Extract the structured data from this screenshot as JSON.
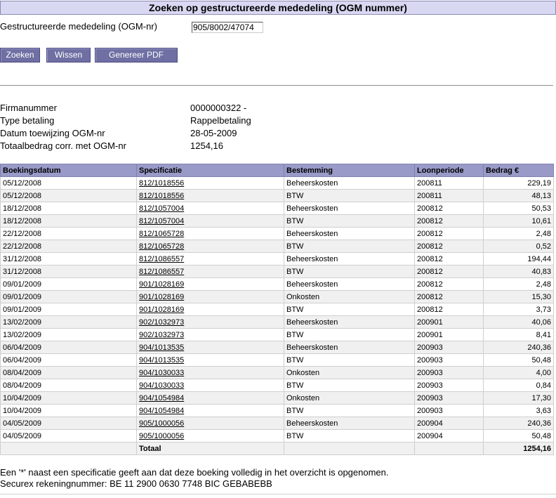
{
  "title": "Zoeken op gestructureerde mededeling (OGM nummer)",
  "form": {
    "label": "Gestructureerde mededeling (OGM-nr)",
    "value": "905/8002/47074"
  },
  "buttons": {
    "search": "Zoeken",
    "clear": "Wissen",
    "pdf": "Genereer PDF"
  },
  "info": [
    {
      "label": "Firmanummer",
      "value": "0000000322 -"
    },
    {
      "label": "Type betaling",
      "value": "Rappelbetaling"
    },
    {
      "label": "Datum toewijzing OGM-nr",
      "value": "28-05-2009"
    },
    {
      "label": "Totaalbedrag corr. met OGM-nr",
      "value": "1254,16"
    }
  ],
  "table": {
    "headers": [
      "Boekingsdatum",
      "Specificatie",
      "Bestemming",
      "Loonperiode",
      "Bedrag €"
    ],
    "rows": [
      [
        "05/12/2008",
        "812/1018556",
        "Beheerskosten",
        "200811",
        "229,19"
      ],
      [
        "05/12/2008",
        "812/1018556",
        "BTW",
        "200811",
        "48,13"
      ],
      [
        "18/12/2008",
        "812/1057004",
        "Beheerskosten",
        "200812",
        "50,53"
      ],
      [
        "18/12/2008",
        "812/1057004",
        "BTW",
        "200812",
        "10,61"
      ],
      [
        "22/12/2008",
        "812/1065728",
        "Beheerskosten",
        "200812",
        "2,48"
      ],
      [
        "22/12/2008",
        "812/1065728",
        "BTW",
        "200812",
        "0,52"
      ],
      [
        "31/12/2008",
        "812/1086557",
        "Beheerskosten",
        "200812",
        "194,44"
      ],
      [
        "31/12/2008",
        "812/1086557",
        "BTW",
        "200812",
        "40,83"
      ],
      [
        "09/01/2009",
        "901/1028169",
        "Beheerskosten",
        "200812",
        "2,48"
      ],
      [
        "09/01/2009",
        "901/1028169",
        "Onkosten",
        "200812",
        "15,30"
      ],
      [
        "09/01/2009",
        "901/1028169",
        "BTW",
        "200812",
        "3,73"
      ],
      [
        "13/02/2009",
        "902/1032973",
        "Beheerskosten",
        "200901",
        "40,06"
      ],
      [
        "13/02/2009",
        "902/1032973",
        "BTW",
        "200901",
        "8,41"
      ],
      [
        "06/04/2009",
        "904/1013535",
        "Beheerskosten",
        "200903",
        "240,36"
      ],
      [
        "06/04/2009",
        "904/1013535",
        "BTW",
        "200903",
        "50,48"
      ],
      [
        "08/04/2009",
        "904/1030033",
        "Onkosten",
        "200903",
        "4,00"
      ],
      [
        "08/04/2009",
        "904/1030033",
        "BTW",
        "200903",
        "0,84"
      ],
      [
        "10/04/2009",
        "904/1054984",
        "Onkosten",
        "200903",
        "17,30"
      ],
      [
        "10/04/2009",
        "904/1054984",
        "BTW",
        "200903",
        "3,63"
      ],
      [
        "04/05/2009",
        "905/1000056",
        "Beheerskosten",
        "200904",
        "240,36"
      ],
      [
        "04/05/2009",
        "905/1000056",
        "BTW",
        "200904",
        "50,48"
      ]
    ],
    "total_label": "Totaal",
    "total_value": "1254,16"
  },
  "footer": {
    "note": "Een '*' naast een specificatie geeft aan dat deze boeking volledig in het overzicht is opgenomen.",
    "account": "Securex rekeningnummer: BE 11 2900 0630 7748 BIC GEBABEBB"
  }
}
